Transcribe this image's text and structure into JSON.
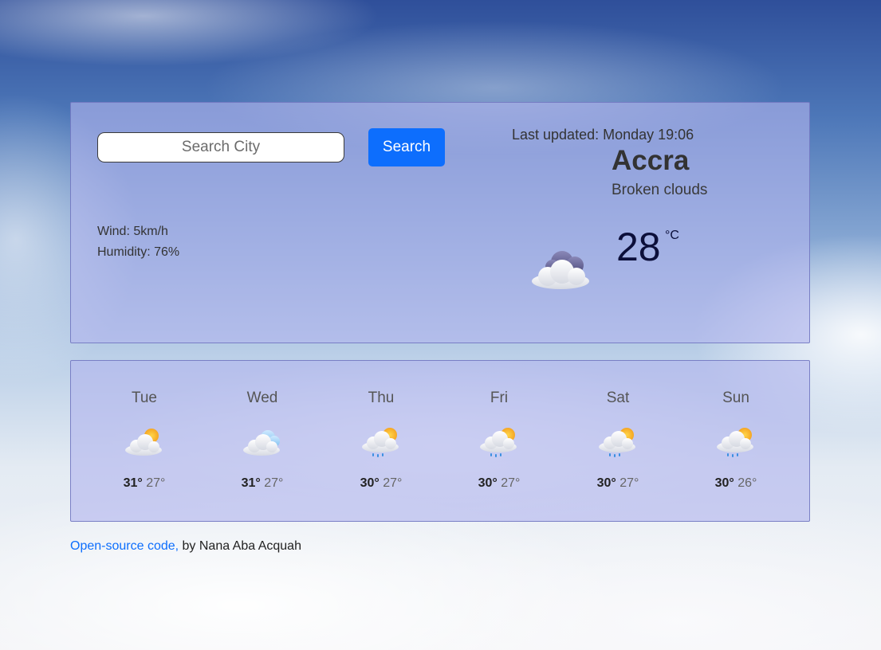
{
  "search": {
    "placeholder": "Search City",
    "button_label": "Search"
  },
  "current": {
    "last_updated": "Last updated: Monday 19:06",
    "city": "Accra",
    "condition": "Broken clouds",
    "wind": "Wind: 5km/h",
    "humidity": "Humidity: 76%",
    "temperature": "28",
    "unit": "°C",
    "icon": "broken-clouds-icon"
  },
  "forecast": [
    {
      "day": "Tue",
      "max": "31°",
      "min": "27°",
      "icon": "sun-cloud-icon"
    },
    {
      "day": "Wed",
      "max": "31°",
      "min": "27°",
      "icon": "clouds-icon"
    },
    {
      "day": "Thu",
      "max": "30°",
      "min": "27°",
      "icon": "sun-rain-icon"
    },
    {
      "day": "Fri",
      "max": "30°",
      "min": "27°",
      "icon": "sun-rain-icon"
    },
    {
      "day": "Sat",
      "max": "30°",
      "min": "27°",
      "icon": "sun-rain-icon"
    },
    {
      "day": "Sun",
      "max": "30°",
      "min": "26°",
      "icon": "sun-rain-icon"
    }
  ],
  "footer": {
    "link_text": "Open-source code,",
    "credit": " by Nana Aba Acquah"
  },
  "colors": {
    "accent": "#0d6efd",
    "card": "#b2b4ee",
    "temperature": "#0c0f3a"
  }
}
